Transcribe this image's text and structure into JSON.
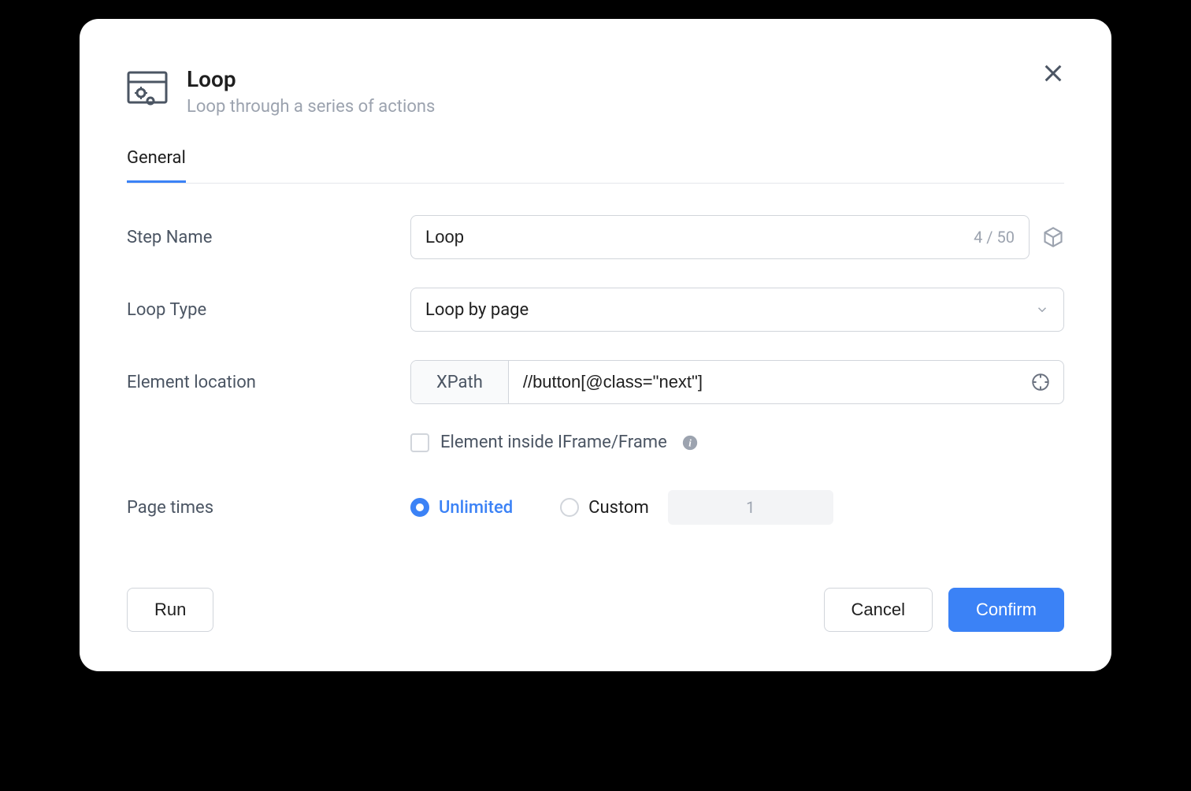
{
  "header": {
    "title": "Loop",
    "subtitle": "Loop through a series of actions"
  },
  "tabs": {
    "general": "General"
  },
  "form": {
    "stepName": {
      "label": "Step Name",
      "value": "Loop",
      "charCount": "4 / 50"
    },
    "loopType": {
      "label": "Loop Type",
      "value": "Loop by page"
    },
    "elementLocation": {
      "label": "Element location",
      "prefix": "XPath",
      "value": "//button[@class=\"next\"]"
    },
    "iframe": {
      "label": "Element inside IFrame/Frame"
    },
    "pageTimes": {
      "label": "Page times",
      "unlimited": "Unlimited",
      "custom": "Custom",
      "customValue": "1"
    }
  },
  "footer": {
    "run": "Run",
    "cancel": "Cancel",
    "confirm": "Confirm"
  }
}
